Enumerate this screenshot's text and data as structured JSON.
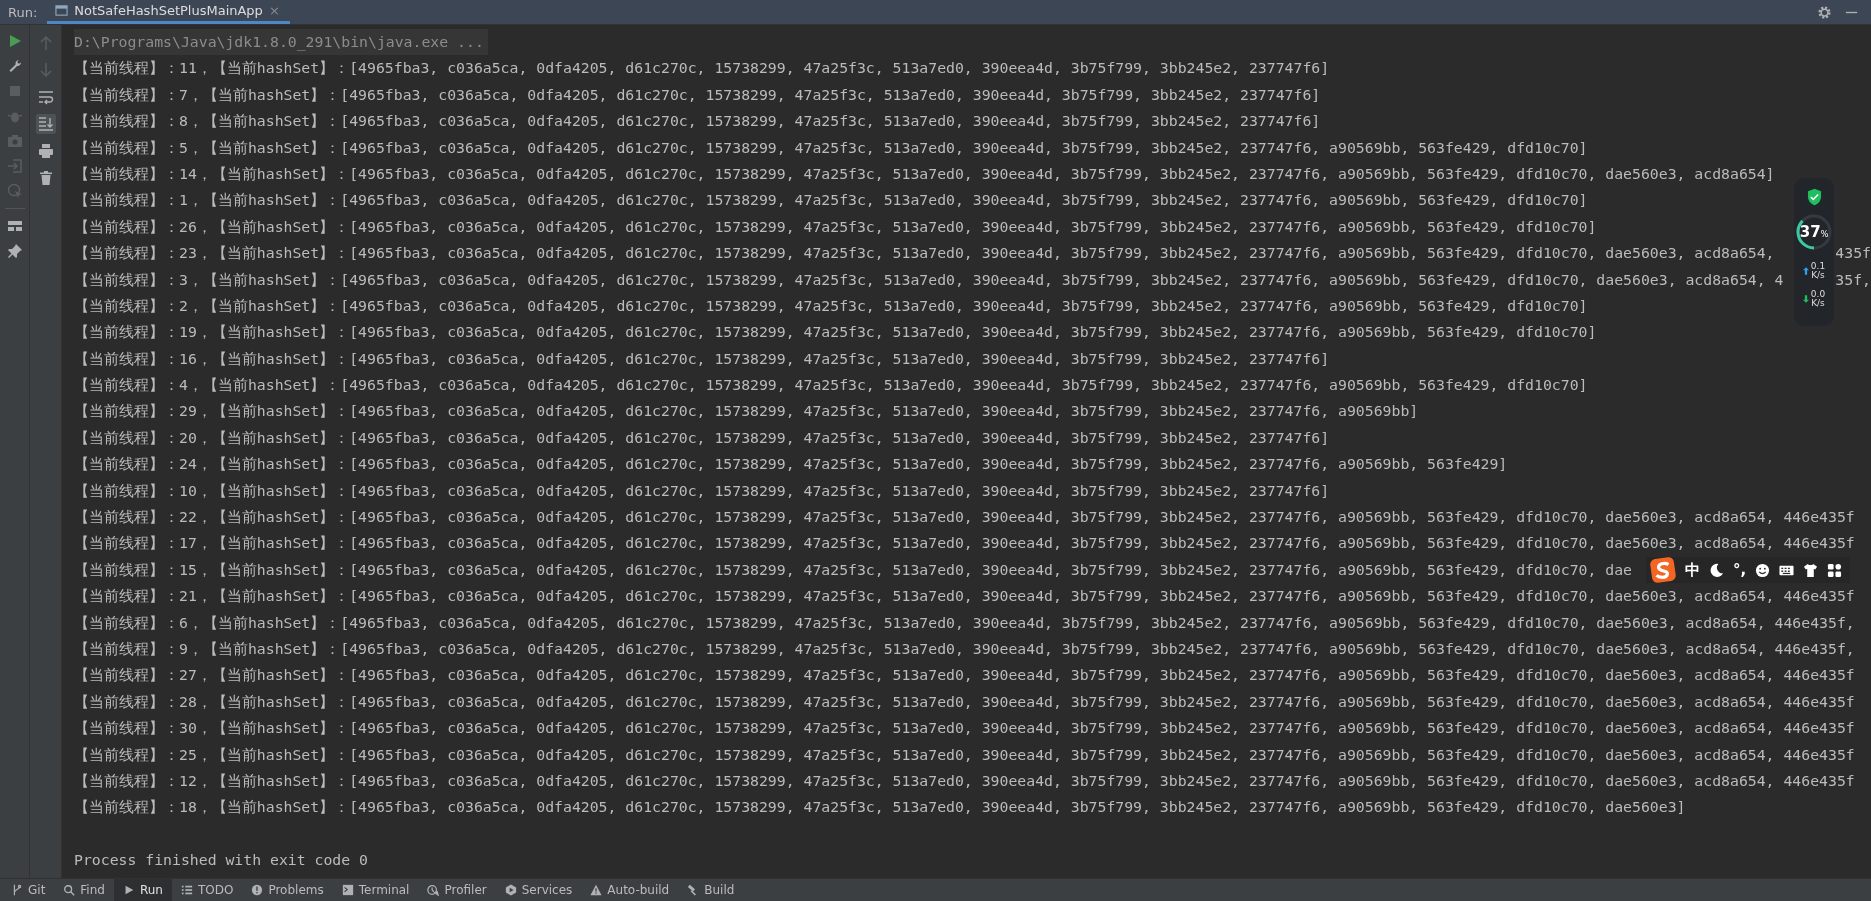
{
  "run_panel": {
    "label": "Run:",
    "tab": {
      "title": "NotSafeHashSetPlusMainApp",
      "selected": true,
      "close": "×"
    }
  },
  "left_toolbar": [
    {
      "kind": "run",
      "disabled": false
    },
    {
      "kind": "wrench",
      "disabled": false
    },
    {
      "kind": "stop",
      "disabled": true
    },
    {
      "kind": "bug",
      "disabled": true
    },
    {
      "kind": "camera",
      "disabled": true
    },
    {
      "kind": "exit",
      "disabled": true
    },
    {
      "kind": "pointer",
      "disabled": true
    },
    {
      "kind": "layout",
      "disabled": false
    },
    {
      "kind": "pin",
      "disabled": false
    }
  ],
  "console_toolbar": [
    {
      "kind": "up",
      "disabled": true,
      "selected": false
    },
    {
      "kind": "down",
      "disabled": true,
      "selected": false
    },
    {
      "kind": "wrap",
      "disabled": false,
      "selected": false
    },
    {
      "kind": "scroll-end",
      "disabled": false,
      "selected": true
    },
    {
      "kind": "print",
      "disabled": false,
      "selected": false
    },
    {
      "kind": "trash",
      "disabled": false,
      "selected": false
    }
  ],
  "console": {
    "command": "D:\\Programs\\Java\\jdk1.8.0_291\\bin\\java.exe ...",
    "lines": [
      {
        "text": "【当前线程】：11，【当前hashSet】：[4965fba3, c036a5ca, 0dfa4205, d61c270c, 15738299, 47a25f3c, 513a7ed0, 390eea4d, 3b75f799, 3bb245e2, 237747f6]"
      },
      {
        "text": "【当前线程】：7，【当前hashSet】：[4965fba3, c036a5ca, 0dfa4205, d61c270c, 15738299, 47a25f3c, 513a7ed0, 390eea4d, 3b75f799, 3bb245e2, 237747f6]"
      },
      {
        "text": "【当前线程】：8，【当前hashSet】：[4965fba3, c036a5ca, 0dfa4205, d61c270c, 15738299, 47a25f3c, 513a7ed0, 390eea4d, 3b75f799, 3bb245e2, 237747f6]"
      },
      {
        "text": "【当前线程】：5，【当前hashSet】：[4965fba3, c036a5ca, 0dfa4205, d61c270c, 15738299, 47a25f3c, 513a7ed0, 390eea4d, 3b75f799, 3bb245e2, 237747f6, a90569bb, 563fe429, dfd10c70]"
      },
      {
        "text": "【当前线程】：14，【当前hashSet】：[4965fba3, c036a5ca, 0dfa4205, d61c270c, 15738299, 47a25f3c, 513a7ed0, 390eea4d, 3b75f799, 3bb245e2, 237747f6, a90569bb, 563fe429, dfd10c70, dae560e3, acd8a654]"
      },
      {
        "text": "【当前线程】：1，【当前hashSet】：[4965fba3, c036a5ca, 0dfa4205, d61c270c, 15738299, 47a25f3c, 513a7ed0, 390eea4d, 3b75f799, 3bb245e2, 237747f6, a90569bb, 563fe429, dfd10c70]"
      },
      {
        "text": "【当前线程】：26，【当前hashSet】：[4965fba3, c036a5ca, 0dfa4205, d61c270c, 15738299, 47a25f3c, 513a7ed0, 390eea4d, 3b75f799, 3bb245e2, 237747f6, a90569bb, 563fe429, dfd10c70]"
      },
      {
        "text": "【当前线程】：23，【当前hashSet】：[4965fba3, c036a5ca, 0dfa4205, d61c270c, 15738299, 47a25f3c, 513a7ed0, 390eea4d, 3b75f799, 3bb245e2, 237747f6, a90569bb, 563fe429, dfd10c70, dae560e3, acd8a654,",
        "tail": "435f"
      },
      {
        "text": "【当前线程】：3，【当前hashSet】：[4965fba3, c036a5ca, 0dfa4205, d61c270c, 15738299, 47a25f3c, 513a7ed0, 390eea4d, 3b75f799, 3bb245e2, 237747f6, a90569bb, 563fe429, dfd10c70, dae560e3, acd8a654, 4",
        "tail": "35f,"
      },
      {
        "text": "【当前线程】：2，【当前hashSet】：[4965fba3, c036a5ca, 0dfa4205, d61c270c, 15738299, 47a25f3c, 513a7ed0, 390eea4d, 3b75f799, 3bb245e2, 237747f6, a90569bb, 563fe429, dfd10c70]"
      },
      {
        "text": "【当前线程】：19，【当前hashSet】：[4965fba3, c036a5ca, 0dfa4205, d61c270c, 15738299, 47a25f3c, 513a7ed0, 390eea4d, 3b75f799, 3bb245e2, 237747f6, a90569bb, 563fe429, dfd10c70]"
      },
      {
        "text": "【当前线程】：16，【当前hashSet】：[4965fba3, c036a5ca, 0dfa4205, d61c270c, 15738299, 47a25f3c, 513a7ed0, 390eea4d, 3b75f799, 3bb245e2, 237747f6]"
      },
      {
        "text": "【当前线程】：4，【当前hashSet】：[4965fba3, c036a5ca, 0dfa4205, d61c270c, 15738299, 47a25f3c, 513a7ed0, 390eea4d, 3b75f799, 3bb245e2, 237747f6, a90569bb, 563fe429, dfd10c70]"
      },
      {
        "text": "【当前线程】：29，【当前hashSet】：[4965fba3, c036a5ca, 0dfa4205, d61c270c, 15738299, 47a25f3c, 513a7ed0, 390eea4d, 3b75f799, 3bb245e2, 237747f6, a90569bb]"
      },
      {
        "text": "【当前线程】：20，【当前hashSet】：[4965fba3, c036a5ca, 0dfa4205, d61c270c, 15738299, 47a25f3c, 513a7ed0, 390eea4d, 3b75f799, 3bb245e2, 237747f6]"
      },
      {
        "text": "【当前线程】：24，【当前hashSet】：[4965fba3, c036a5ca, 0dfa4205, d61c270c, 15738299, 47a25f3c, 513a7ed0, 390eea4d, 3b75f799, 3bb245e2, 237747f6, a90569bb, 563fe429]"
      },
      {
        "text": "【当前线程】：10，【当前hashSet】：[4965fba3, c036a5ca, 0dfa4205, d61c270c, 15738299, 47a25f3c, 513a7ed0, 390eea4d, 3b75f799, 3bb245e2, 237747f6]"
      },
      {
        "text": "【当前线程】：22，【当前hashSet】：[4965fba3, c036a5ca, 0dfa4205, d61c270c, 15738299, 47a25f3c, 513a7ed0, 390eea4d, 3b75f799, 3bb245e2, 237747f6, a90569bb, 563fe429, dfd10c70, dae560e3, acd8a654, 446e435f"
      },
      {
        "text": "【当前线程】：17，【当前hashSet】：[4965fba3, c036a5ca, 0dfa4205, d61c270c, 15738299, 47a25f3c, 513a7ed0, 390eea4d, 3b75f799, 3bb245e2, 237747f6, a90569bb, 563fe429, dfd10c70, dae560e3, acd8a654, 446e435f"
      },
      {
        "text": "【当前线程】：15，【当前hashSet】：[4965fba3, c036a5ca, 0dfa4205, d61c270c, 15738299, 47a25f3c, 513a7ed0, 390eea4d, 3b75f799, 3bb245e2, 237747f6, a90569bb, 563fe429, dfd10c70, dae"
      },
      {
        "text": "【当前线程】：21，【当前hashSet】：[4965fba3, c036a5ca, 0dfa4205, d61c270c, 15738299, 47a25f3c, 513a7ed0, 390eea4d, 3b75f799, 3bb245e2, 237747f6, a90569bb, 563fe429, dfd10c70, dae560e3, acd8a654, 446e435f"
      },
      {
        "text": "【当前线程】：6，【当前hashSet】：[4965fba3, c036a5ca, 0dfa4205, d61c270c, 15738299, 47a25f3c, 513a7ed0, 390eea4d, 3b75f799, 3bb245e2, 237747f6, a90569bb, 563fe429, dfd10c70, dae560e3, acd8a654, 446e435f,"
      },
      {
        "text": "【当前线程】：9，【当前hashSet】：[4965fba3, c036a5ca, 0dfa4205, d61c270c, 15738299, 47a25f3c, 513a7ed0, 390eea4d, 3b75f799, 3bb245e2, 237747f6, a90569bb, 563fe429, dfd10c70, dae560e3, acd8a654, 446e435f,"
      },
      {
        "text": "【当前线程】：27，【当前hashSet】：[4965fba3, c036a5ca, 0dfa4205, d61c270c, 15738299, 47a25f3c, 513a7ed0, 390eea4d, 3b75f799, 3bb245e2, 237747f6, a90569bb, 563fe429, dfd10c70, dae560e3, acd8a654, 446e435f"
      },
      {
        "text": "【当前线程】：28，【当前hashSet】：[4965fba3, c036a5ca, 0dfa4205, d61c270c, 15738299, 47a25f3c, 513a7ed0, 390eea4d, 3b75f799, 3bb245e2, 237747f6, a90569bb, 563fe429, dfd10c70, dae560e3, acd8a654, 446e435f"
      },
      {
        "text": "【当前线程】：30，【当前hashSet】：[4965fba3, c036a5ca, 0dfa4205, d61c270c, 15738299, 47a25f3c, 513a7ed0, 390eea4d, 3b75f799, 3bb245e2, 237747f6, a90569bb, 563fe429, dfd10c70, dae560e3, acd8a654, 446e435f"
      },
      {
        "text": "【当前线程】：25，【当前hashSet】：[4965fba3, c036a5ca, 0dfa4205, d61c270c, 15738299, 47a25f3c, 513a7ed0, 390eea4d, 3b75f799, 3bb245e2, 237747f6, a90569bb, 563fe429, dfd10c70, dae560e3, acd8a654, 446e435f"
      },
      {
        "text": "【当前线程】：12，【当前hashSet】：[4965fba3, c036a5ca, 0dfa4205, d61c270c, 15738299, 47a25f3c, 513a7ed0, 390eea4d, 3b75f799, 3bb245e2, 237747f6, a90569bb, 563fe429, dfd10c70, dae560e3, acd8a654, 446e435f"
      },
      {
        "text": "【当前线程】：18，【当前hashSet】：[4965fba3, c036a5ca, 0dfa4205, d61c270c, 15738299, 47a25f3c, 513a7ed0, 390eea4d, 3b75f799, 3bb245e2, 237747f6, a90569bb, 563fe429, dfd10c70, dae560e3]"
      }
    ],
    "exit_message": "Process finished with exit code 0"
  },
  "bottom_tools": [
    {
      "kind": "git",
      "label": "Git",
      "selected": false
    },
    {
      "kind": "find",
      "label": "Find",
      "selected": false
    },
    {
      "kind": "run",
      "label": "Run",
      "selected": true
    },
    {
      "kind": "todo",
      "label": "TODO",
      "selected": false
    },
    {
      "kind": "problems",
      "label": "Problems",
      "selected": false
    },
    {
      "kind": "terminal",
      "label": "Terminal",
      "selected": false
    },
    {
      "kind": "profiler",
      "label": "Profiler",
      "selected": false
    },
    {
      "kind": "services",
      "label": "Services",
      "selected": false
    },
    {
      "kind": "auto-build",
      "label": "Auto-build",
      "selected": false
    },
    {
      "kind": "build",
      "label": "Build",
      "selected": false
    }
  ],
  "security_widget": {
    "percent": "37",
    "unit": "%",
    "level": 0.37,
    "upload": "0.1",
    "upload_unit": "K/s",
    "download": "0.0",
    "download_unit": "K/s"
  },
  "ime_toolbar": {
    "mode": "中",
    "punctuation": "°,"
  }
}
